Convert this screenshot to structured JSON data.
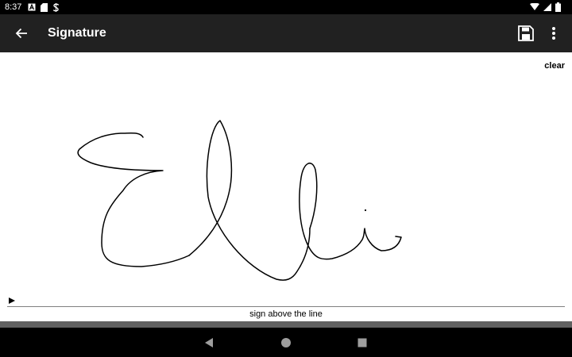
{
  "status_bar": {
    "time": "8:37",
    "left_icons": [
      "notification-a-icon",
      "sd-card-icon",
      "sync-s-icon"
    ],
    "right_icons": [
      "wifi-icon",
      "cell-signal-icon",
      "battery-icon"
    ]
  },
  "toolbar": {
    "title": "Signature",
    "back_icon": "arrow-back-icon",
    "save_icon": "save-floppy-icon",
    "more_icon": "more-vert-icon"
  },
  "canvas": {
    "clear_label": "clear",
    "hint": "sign above the line",
    "ink_color": "#000000",
    "line_color": "#808080"
  },
  "nav_bar": {
    "icons": [
      "back-triangle-icon",
      "home-circle-icon",
      "recents-square-icon"
    ]
  },
  "colors": {
    "status_bar": "#000000",
    "toolbar": "#212121",
    "canvas": "#ffffff",
    "nav_bar": "#000000"
  }
}
